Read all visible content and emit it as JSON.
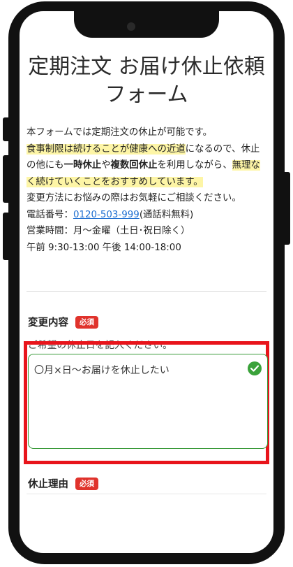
{
  "page": {
    "title": "定期注文 お届け休止依頼フォーム"
  },
  "intro": {
    "line1": "本フォームでは定期注文の休止が可能です。",
    "hl1": "食事制限は続けることが健康への近道",
    "mid1": "になるので、休止の他にも",
    "bold1": "一時休止",
    "mid2": "や",
    "bold2": "複数回休止",
    "mid3": "を利用しながら、",
    "hl2": "無理なく続けていくことをおすすめしています。",
    "consult": "変更方法にお悩みの際はお気軽にご相談ください。",
    "phone_label": "電話番号：",
    "phone_number": "0120-503-999",
    "phone_note": "(通話料無料)",
    "hours": "営業時間：月〜金曜（土日･祝日除く）",
    "times": "午前 9:30-13:00 午後 14:00-18:00"
  },
  "change_field": {
    "label": "変更内容",
    "required_badge": "必須",
    "helper": "ご希望の休止日を記入ください。",
    "value": "〇月×日〜お届けを休止したい"
  },
  "reason_field": {
    "label": "休止理由",
    "required_badge": "必須"
  },
  "colors": {
    "highlight_yellow": "#fdf5a6",
    "required_red": "#e0332c",
    "valid_green": "#3aa23a",
    "focus_red_box": "#e8141b",
    "link_blue": "#1f6fd1"
  },
  "icons": {
    "valid": "check-circle-icon"
  }
}
